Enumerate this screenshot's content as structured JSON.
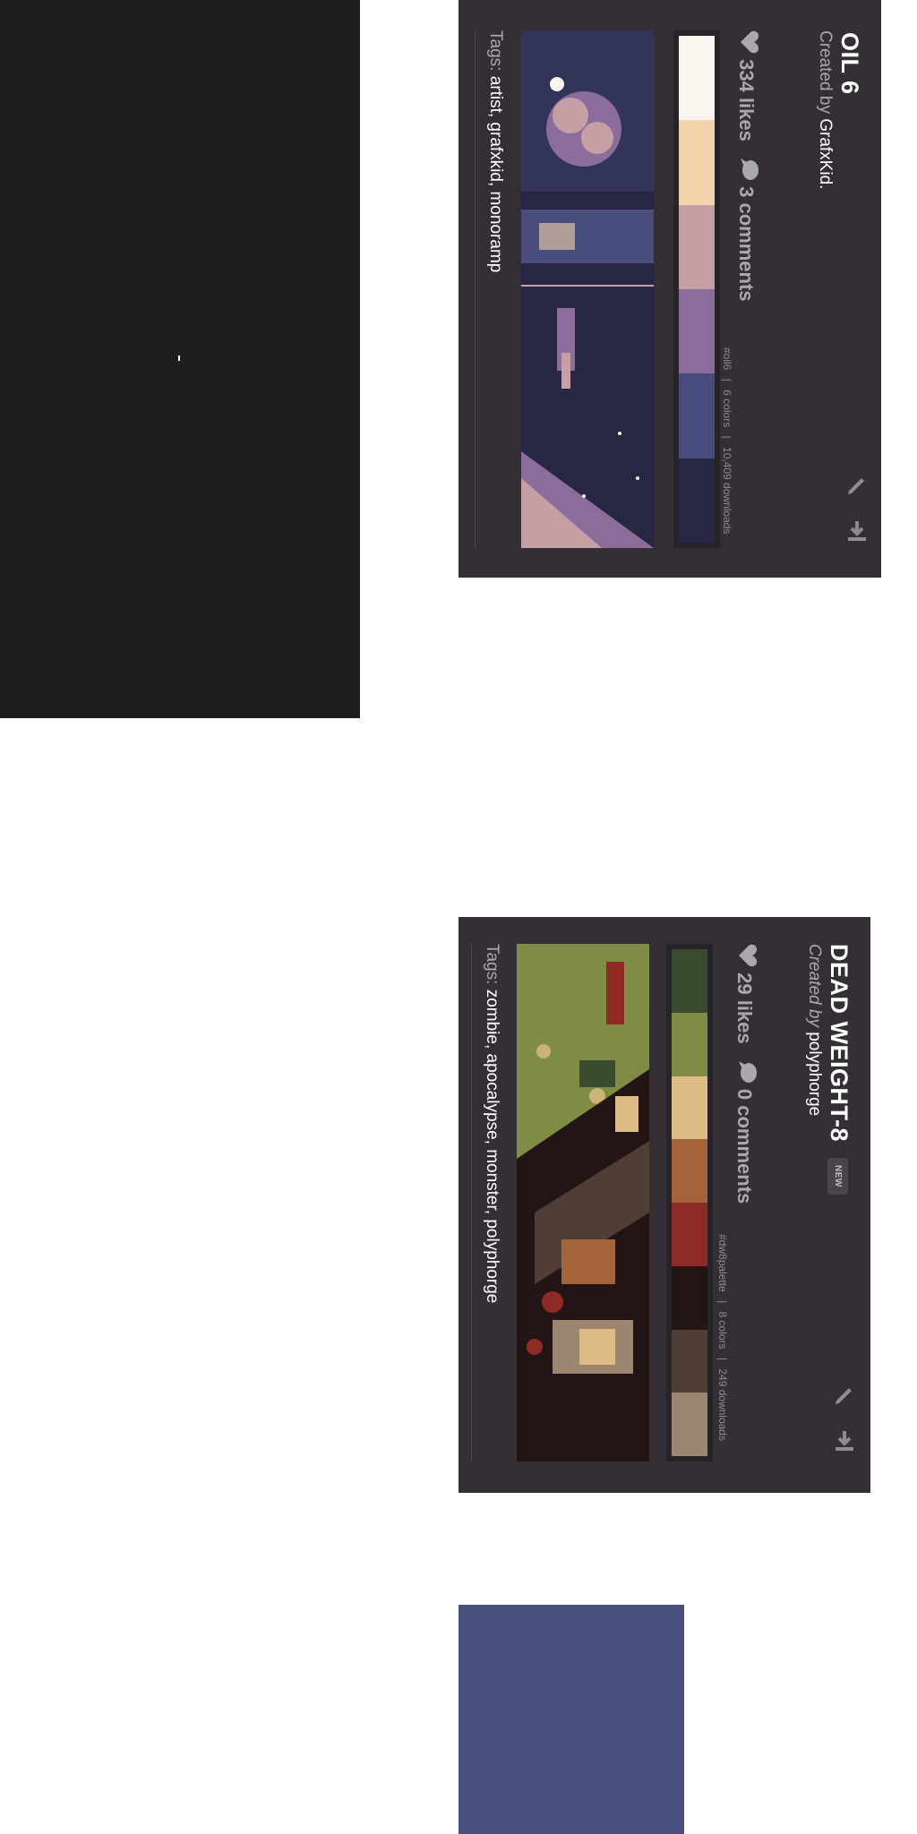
{
  "palettes": [
    {
      "title": "OIL 6",
      "created_prefix": "Created by",
      "author": "GrafxKid.",
      "likes": "334 likes",
      "comments": "3 comments",
      "slug": "#oil6",
      "color_count": "6 colors",
      "downloads": "10,409 downloads",
      "tags_label": "Tags:",
      "tags": "artist, grafxkid, monoramp",
      "colors": [
        "#fbf5ef",
        "#f2d3ab",
        "#c69fa5",
        "#8b6d9c",
        "#494d7e",
        "#272744"
      ]
    },
    {
      "title": "DEAD WEIGHT-8",
      "badge": "NEW",
      "created_prefix": "Created by",
      "author": "polyphorge",
      "likes": "29 likes",
      "comments": "0 comments",
      "slug": "#dw8palette",
      "color_count": "8 colors",
      "downloads": "249 downloads",
      "tags_label": "Tags:",
      "tags": "zombie, apocalypse, monster, polyphorge",
      "colors": [
        "#3b4b30",
        "#7f8c44",
        "#ddbb86",
        "#a4643b",
        "#8d2b24",
        "#231516",
        "#4f3d36",
        "#9b8671"
      ]
    }
  ],
  "icons": {
    "heart": "heart-icon",
    "comment": "comment-icon",
    "edit": "pencil-icon",
    "download": "download-icon"
  }
}
